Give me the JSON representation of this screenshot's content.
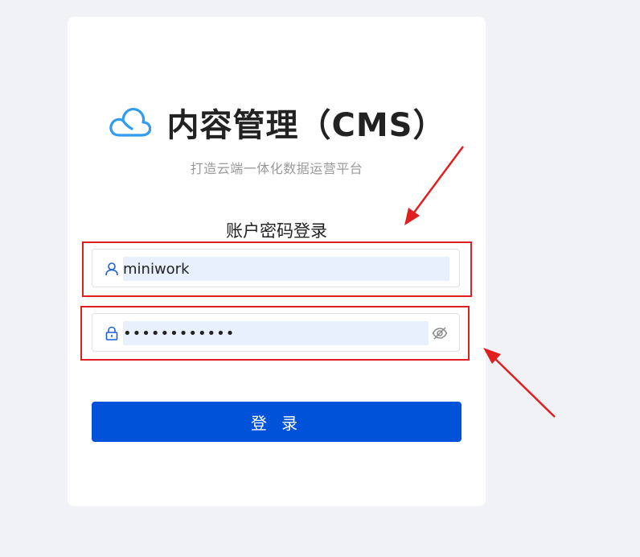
{
  "brand": {
    "title": "内容管理（CMS）",
    "subtitle": "打造云端一体化数据运营平台",
    "logo_icon": "cloud-icon",
    "accent": "#2f9cf0"
  },
  "login": {
    "mode_title": "账户密码登录",
    "username": {
      "value": "miniwork",
      "icon": "user-icon"
    },
    "password": {
      "value": "12345678abcd",
      "icon": "lock-icon",
      "toggle_icon": "eye-off-icon"
    },
    "submit_label": "登 录",
    "submit_color": "#0052d9"
  },
  "annotations": {
    "highlight_color": "#e02020"
  }
}
